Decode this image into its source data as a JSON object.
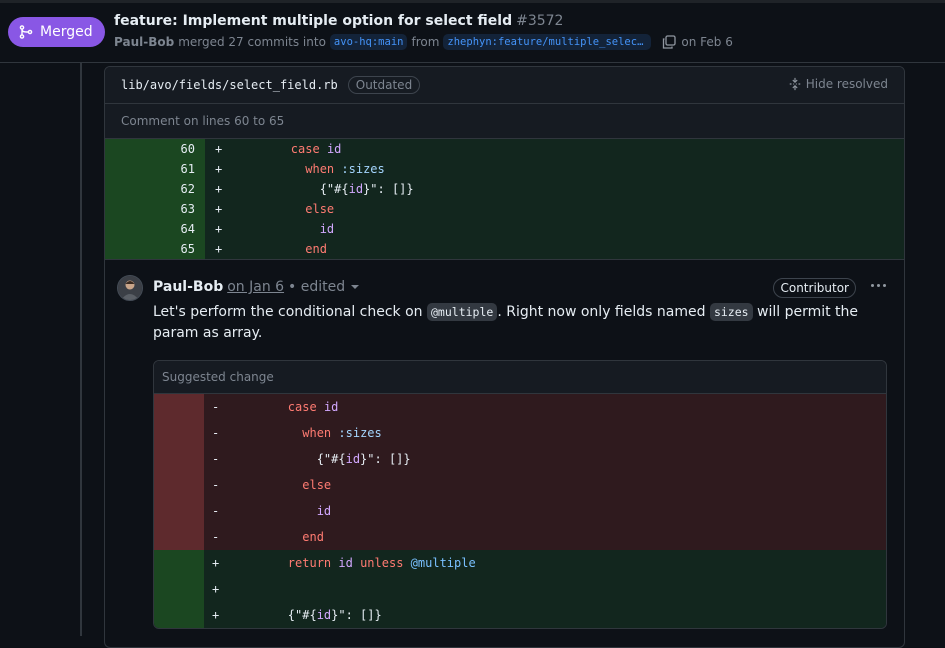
{
  "pr": {
    "badge_label": "Merged",
    "title": "feature: Implement multiple option for select field",
    "number": "#3572",
    "author": "Paul-Bob",
    "merged_text": "merged 27 commits into",
    "base_branch": "avo-hq:main",
    "from_text": "from",
    "head_branch": "zhephyn:feature/multiple_select…",
    "date_text": "on Feb 6"
  },
  "review": {
    "file_path": "lib/avo/fields/select_field.rb",
    "outdated_label": "Outdated",
    "hide_resolved_label": "Hide resolved",
    "comment_on_lines": "Comment on lines 60 to 65",
    "diff_numbers": [
      "60",
      "61",
      "62",
      "63",
      "64",
      "65"
    ]
  },
  "comment": {
    "author": "Paul-Bob",
    "date": "on Jan 6",
    "edited": "• edited",
    "contributor_label": "Contributor",
    "body_part1": "Let's perform the conditional check on ",
    "code1": "@multiple",
    "body_part2": ". Right now only fields named ",
    "code2": "sizes",
    "body_part3": " will permit the param as array.",
    "suggested_label": "Suggested change"
  },
  "colors": {
    "merged_purple": "#8957e5",
    "add_gutter": "#1b4721",
    "del_gutter": "#5e2a2d"
  }
}
